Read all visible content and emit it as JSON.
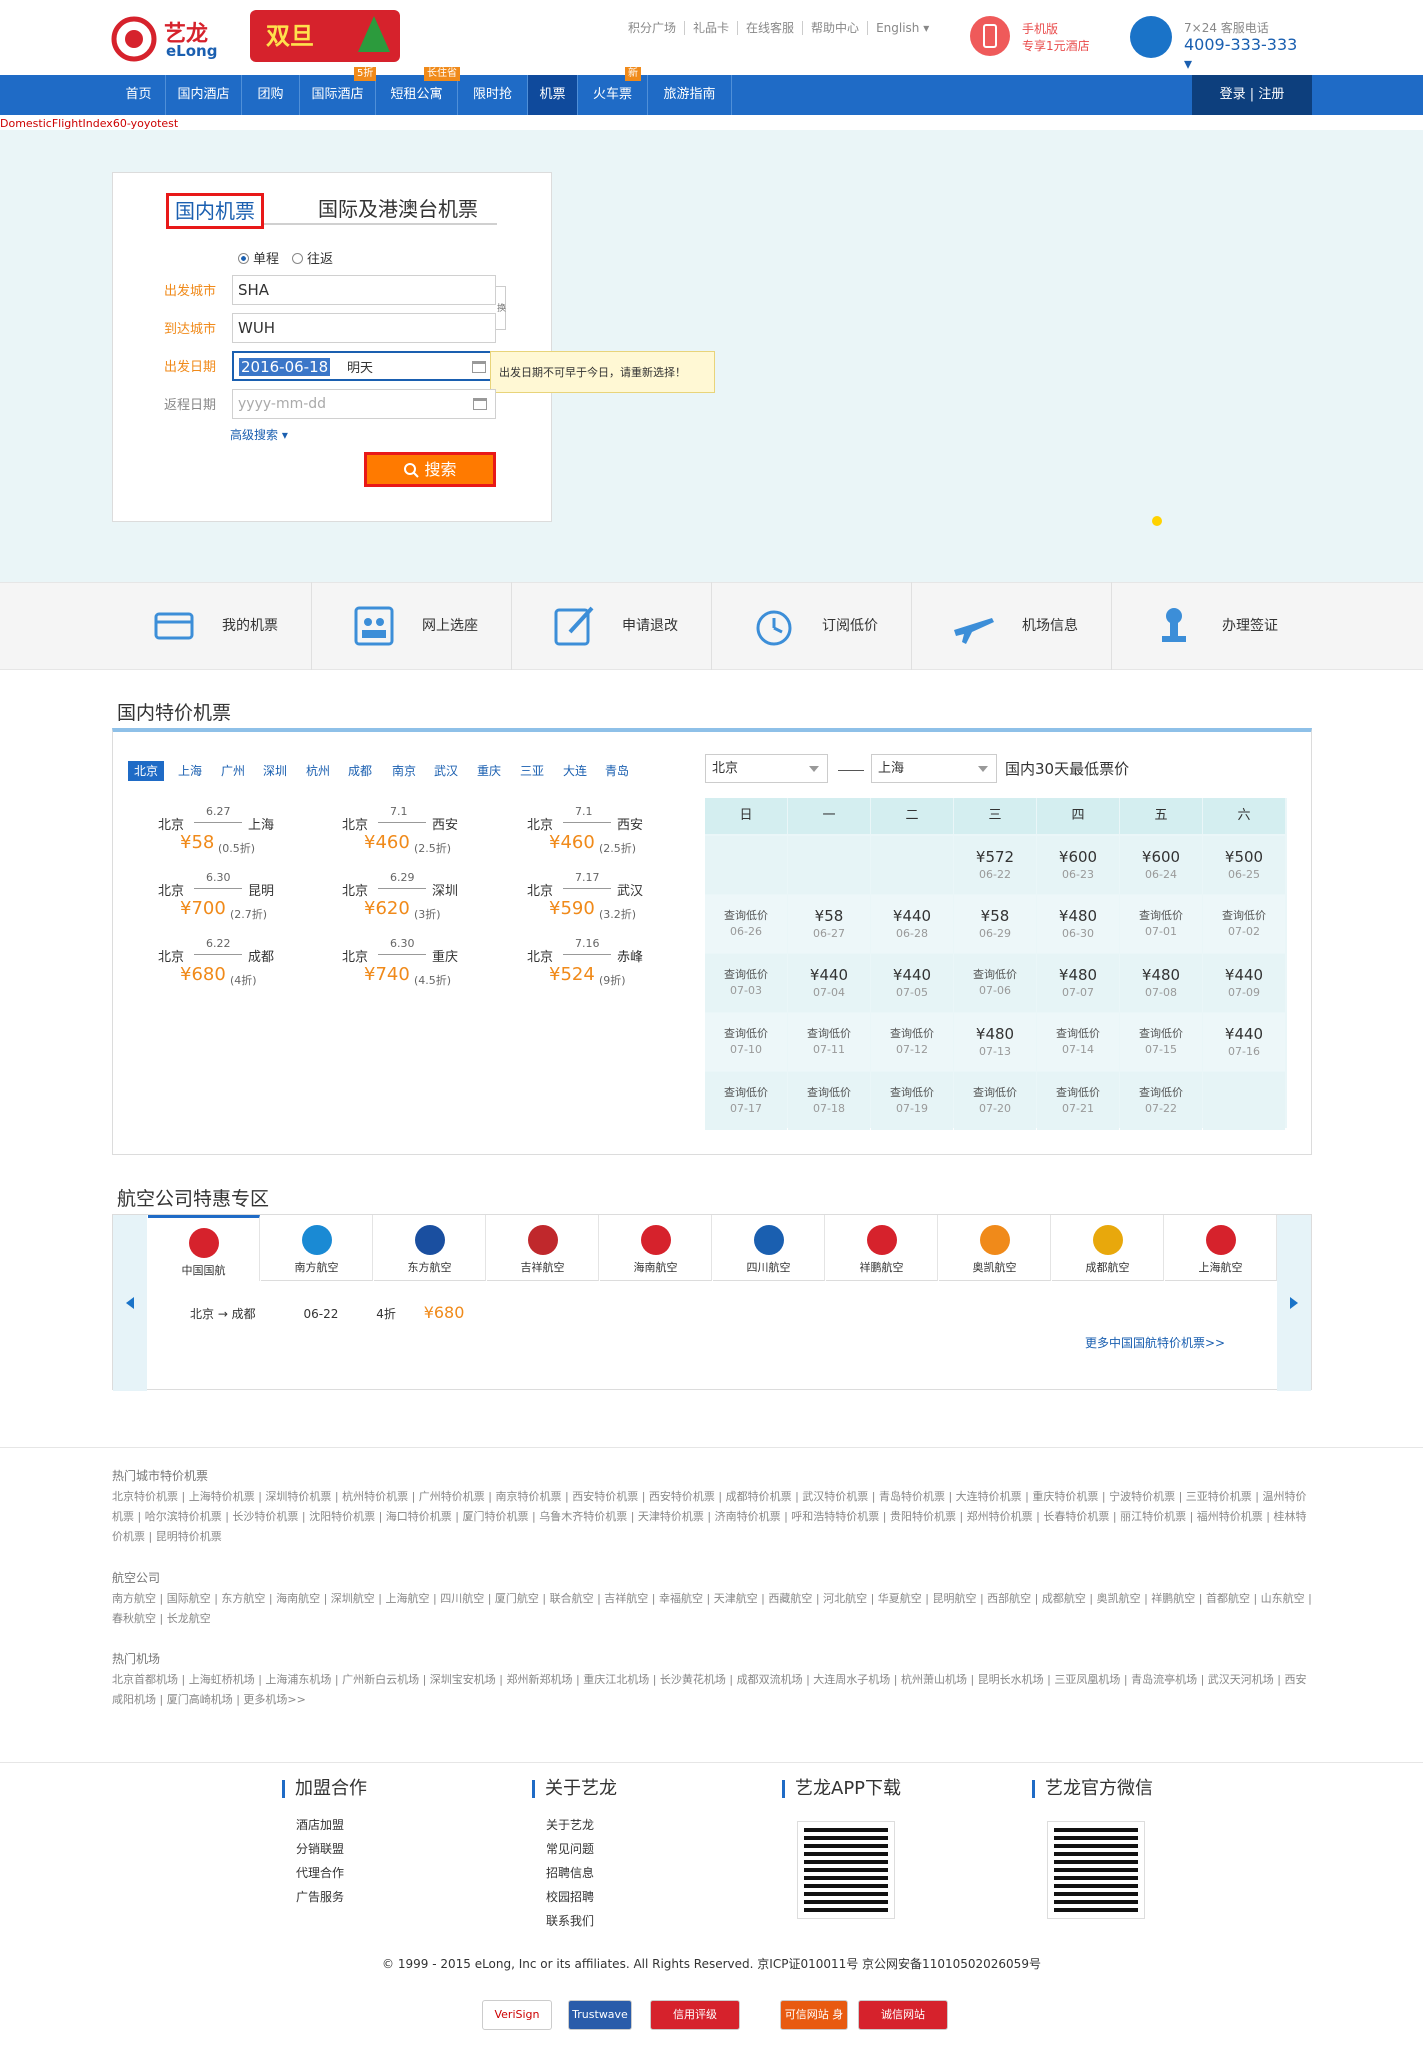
{
  "header": {
    "logo_cn": "艺龙",
    "logo_en": "eLong",
    "promo": "双旦",
    "top_links": [
      "积分广场",
      "礼品卡",
      "在线客服",
      "帮助中心",
      "English ▾"
    ],
    "mobile_l1": "手机版",
    "mobile_l2": "专享1元酒店",
    "hotline_label": "7×24 客服电话",
    "hotline_number": "4009-333-333 ▾"
  },
  "nav": {
    "items": [
      "首页",
      "国内酒店",
      "团购",
      "国际酒店",
      "短租公寓",
      "限时抢",
      "机票",
      "火车票",
      "旅游指南"
    ],
    "tags": [
      "5折",
      "长住省",
      "新"
    ],
    "login": "登录 | 注册"
  },
  "debug_label": "DomesticFlightIndex60-yoyotest",
  "search": {
    "tab_domestic": "国内机票",
    "tab_intl": "国际及港澳台机票",
    "trip_oneway": "单程",
    "trip_round": "往返",
    "from_label": "出发城市",
    "from_value": "SHA",
    "to_label": "到达城市",
    "to_value": "WUH",
    "swap_label": "换",
    "depart_label": "出发日期",
    "depart_value": "2016-06-18",
    "depart_hint": "明天",
    "return_label": "返程日期",
    "return_placeholder": "yyyy-mm-dd",
    "tooltip": "出发日期不可早于今日，请重新选择！",
    "advanced": "高级搜索 ▾",
    "button": "搜索"
  },
  "services": [
    "我的机票",
    "网上选座",
    "申请退改",
    "订阅低价",
    "机场信息",
    "办理签证"
  ],
  "deals": {
    "title": "国内特价机票",
    "cities": [
      "北京",
      "上海",
      "广州",
      "深圳",
      "杭州",
      "成都",
      "南京",
      "武汉",
      "重庆",
      "三亚",
      "大连",
      "青岛"
    ],
    "routes": [
      {
        "from": "北京",
        "to": "上海",
        "date": "6.27",
        "price": "¥58",
        "disc": "(0.5折)"
      },
      {
        "from": "北京",
        "to": "西安",
        "date": "7.1",
        "price": "¥460",
        "disc": "(2.5折)"
      },
      {
        "from": "北京",
        "to": "西安",
        "date": "7.1",
        "price": "¥460",
        "disc": "(2.5折)"
      },
      {
        "from": "北京",
        "to": "昆明",
        "date": "6.30",
        "price": "¥700",
        "disc": "(2.7折)"
      },
      {
        "from": "北京",
        "to": "深圳",
        "date": "6.29",
        "price": "¥620",
        "disc": "(3折)"
      },
      {
        "from": "北京",
        "to": "武汉",
        "date": "7.17",
        "price": "¥590",
        "disc": "(3.2折)"
      },
      {
        "from": "北京",
        "to": "成都",
        "date": "6.22",
        "price": "¥680",
        "disc": "(4折)"
      },
      {
        "from": "北京",
        "to": "重庆",
        "date": "6.30",
        "price": "¥740",
        "disc": "(4.5折)"
      },
      {
        "from": "北京",
        "to": "赤峰",
        "date": "7.16",
        "price": "¥524",
        "disc": "(9折)"
      }
    ],
    "cal_from": "北京",
    "cal_to": "上海",
    "cal_title": "国内30天最低票价",
    "weekdays": [
      "日",
      "一",
      "二",
      "三",
      "四",
      "五",
      "六"
    ],
    "cal_rows": [
      [
        null,
        null,
        null,
        {
          "p": "¥572",
          "d": "06-22"
        },
        {
          "p": "¥600",
          "d": "06-23"
        },
        {
          "p": "¥600",
          "d": "06-24"
        },
        {
          "p": "¥500",
          "d": "06-25"
        }
      ],
      [
        {
          "p": "查询低价",
          "d": "06-26"
        },
        {
          "p": "¥58",
          "d": "06-27"
        },
        {
          "p": "¥440",
          "d": "06-28"
        },
        {
          "p": "¥58",
          "d": "06-29"
        },
        {
          "p": "¥480",
          "d": "06-30"
        },
        {
          "p": "查询低价",
          "d": "07-01"
        },
        {
          "p": "查询低价",
          "d": "07-02"
        }
      ],
      [
        {
          "p": "查询低价",
          "d": "07-03"
        },
        {
          "p": "¥440",
          "d": "07-04"
        },
        {
          "p": "¥440",
          "d": "07-05"
        },
        {
          "p": "查询低价",
          "d": "07-06"
        },
        {
          "p": "¥480",
          "d": "07-07"
        },
        {
          "p": "¥480",
          "d": "07-08"
        },
        {
          "p": "¥440",
          "d": "07-09"
        }
      ],
      [
        {
          "p": "查询低价",
          "d": "07-10"
        },
        {
          "p": "查询低价",
          "d": "07-11"
        },
        {
          "p": "查询低价",
          "d": "07-12"
        },
        {
          "p": "¥480",
          "d": "07-13"
        },
        {
          "p": "查询低价",
          "d": "07-14"
        },
        {
          "p": "查询低价",
          "d": "07-15"
        },
        {
          "p": "¥440",
          "d": "07-16"
        }
      ],
      [
        {
          "p": "查询低价",
          "d": "07-17"
        },
        {
          "p": "查询低价",
          "d": "07-18"
        },
        {
          "p": "查询低价",
          "d": "07-19"
        },
        {
          "p": "查询低价",
          "d": "07-20"
        },
        {
          "p": "查询低价",
          "d": "07-21"
        },
        {
          "p": "查询低价",
          "d": "07-22"
        },
        null
      ]
    ]
  },
  "airlines": {
    "title": "航空公司特惠专区",
    "list": [
      "中国国航",
      "南方航空",
      "东方航空",
      "吉祥航空",
      "海南航空",
      "四川航空",
      "祥鹏航空",
      "奥凯航空",
      "成都航空",
      "上海航空"
    ],
    "colors": [
      "#d6222c",
      "#1a8ad4",
      "#1a4fa0",
      "#c0282c",
      "#d6222c",
      "#1a5fb0",
      "#d6222c",
      "#f08a1a",
      "#e8a80c",
      "#d6222c"
    ],
    "row_route": "北京 → 成都",
    "row_date": "06-22",
    "row_disc": "4折",
    "row_price": "¥680",
    "more": "更多中国国航特价机票>>"
  },
  "links": {
    "hot_cities_title": "热门城市特价机票",
    "hot_cities_text": "北京特价机票 | 上海特价机票 | 深圳特价机票 | 杭州特价机票 | 广州特价机票 | 南京特价机票 | 西安特价机票 | 西安特价机票 | 成都特价机票 | 武汉特价机票 | 青岛特价机票 | 大连特价机票 | 重庆特价机票 | 宁波特价机票 | 三亚特价机票 | 温州特价机票 | 哈尔滨特价机票 | 长沙特价机票 | 沈阳特价机票 | 海口特价机票 | 厦门特价机票 | 乌鲁木齐特价机票 | 天津特价机票 | 济南特价机票 | 呼和浩特特价机票 | 贵阳特价机票 | 郑州特价机票 | 长春特价机票 | 丽江特价机票 | 福州特价机票 | 桂林特价机票 | 昆明特价机票",
    "airlines_title": "航空公司",
    "airlines_text": "南方航空 | 国际航空 | 东方航空 | 海南航空 | 深圳航空 | 上海航空 | 四川航空 | 厦门航空 | 联合航空 | 吉祥航空 | 幸福航空 | 天津航空 | 西藏航空 | 河北航空 | 华夏航空 | 昆明航空 | 西部航空 | 成都航空 | 奥凯航空 | 祥鹏航空 | 首都航空 | 山东航空 | 春秋航空 | 长龙航空",
    "airports_title": "热门机场",
    "airports_text": "北京首都机场 | 上海虹桥机场 | 上海浦东机场 | 广州新白云机场 | 深圳宝安机场 | 郑州新郑机场 | 重庆江北机场 | 长沙黄花机场 | 成都双流机场 | 大连周水子机场 | 杭州萧山机场 | 昆明长水机场 | 三亚凤凰机场 | 青岛流亭机场 | 武汉天河机场 | 西安咸阳机场 | 厦门高崎机场 | 更多机场>>"
  },
  "footer": {
    "col1_title": "加盟合作",
    "col1_items": [
      "酒店加盟",
      "分销联盟",
      "代理合作",
      "广告服务"
    ],
    "col2_title": "关于艺龙",
    "col2_items": [
      "关于艺龙",
      "常见问题",
      "招聘信息",
      "校园招聘",
      "联系我们"
    ],
    "col3_title": "艺龙APP下载",
    "col4_title": "艺龙官方微信",
    "copyright": "© 1999 - 2015 eLong, Inc or its affiliates. All Rights Reserved. 京ICP证010011号 京公网安备11010502026059号",
    "badges": [
      "VeriSign",
      "Trustwave",
      "信用评级",
      "可信网站 身份验证",
      "诚信网站"
    ]
  }
}
